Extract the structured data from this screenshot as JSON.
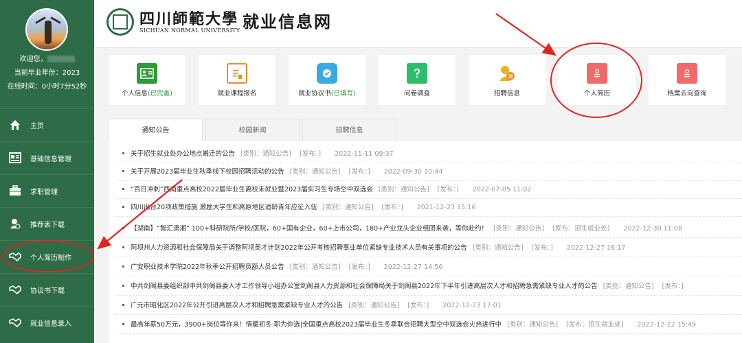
{
  "sidebar": {
    "welcome": "欢迎您，",
    "grad_year": "当前毕业年份：2023",
    "online_time": "在线时间：0小时7分52秒",
    "items": [
      {
        "label": "主页",
        "icon": "home-icon"
      },
      {
        "label": "基础信息管理",
        "icon": "id-card-icon"
      },
      {
        "label": "求职管理",
        "icon": "briefcase-icon"
      },
      {
        "label": "推荐表下载",
        "icon": "user-download-icon"
      },
      {
        "label": "个人简历制作",
        "icon": "handshake-icon"
      },
      {
        "label": "协议书下载",
        "icon": "handshake-icon"
      },
      {
        "label": "就业信息录入",
        "icon": "handshake-icon"
      }
    ]
  },
  "header": {
    "university_cn": "四川師範大學",
    "university_en": "SICHUAN NORMAL UNIVERSITY",
    "site_title": "就业信息网"
  },
  "cards": [
    {
      "label": "个人信息",
      "status": "(已完善)",
      "icon": "id-card-icon",
      "color": "#2e9a3a"
    },
    {
      "label": "就业课程报名",
      "status": "",
      "icon": "document-icon",
      "color": "#f08a24"
    },
    {
      "label": "就业协议书",
      "status": "(已填写)",
      "icon": "shield-check-icon",
      "color": "#3aa9e0"
    },
    {
      "label": "问卷调查",
      "status": "",
      "icon": "question-icon",
      "color": "#2ebd6b"
    },
    {
      "label": "招聘信息",
      "status": "",
      "icon": "recruit-icon",
      "color": "#f0b21a"
    },
    {
      "label": "个人简历",
      "status": "",
      "icon": "resume-icon",
      "color": "#f06a6a"
    },
    {
      "label": "档案去向查询",
      "status": "",
      "icon": "archive-icon",
      "color": "#f06a6a"
    }
  ],
  "tabs": [
    "通知公告",
    "校园新闻",
    "招聘信息"
  ],
  "news": [
    {
      "title": "关于招生就业处办公地点搬迁的公告",
      "category": "[类别：通知公告]",
      "publisher": "[发布：]",
      "date": "2022-11-11 09:37"
    },
    {
      "title": "关于开展2023届毕业生秋季线下校园招聘活动的公告",
      "category": "[类别：通知公告]",
      "publisher": "[发布：]",
      "date": "2022-09-30 10:44"
    },
    {
      "title": "“百日冲刺”西南重点高校2022届毕业生离校未就业暨2023届实习生专场空中双选会",
      "category": "[类别：通知公告]",
      "publisher": "[发布：]",
      "date": "2022-07-05 11:02"
    },
    {
      "title": "四川出台20项政策措施 激励大学生和高原地区适龄青年应征入伍",
      "category": "[类别：通知公告]",
      "publisher": "[发布：]",
      "date": "2021-12-23 15:16"
    },
    {
      "title": "【湖南】“智汇潇湘” 100+科研院所/学校/医院，60+国有企业，60+上市公司，180+产业龙头企业组团来袭，等你赴约！",
      "category": "[类别：通知公告]",
      "publisher": "[发布：招生就业处]",
      "date": "2022-12-30 11:08"
    },
    {
      "title": "阿坝州人力资源和社会保障局关于调整阿坝英才计划2022年公开考核招聘事业单位紧缺专业技术人员有关事项的公告",
      "category": "[类别：通知公告]",
      "publisher": "[发布：]",
      "date": "2022-12-27 16:17"
    },
    {
      "title": "广安职业技术学院2022年秋季公开招聘员额人员公告",
      "category": "[类别：通知公告]",
      "publisher": "[发布：]",
      "date": "2022-12-27 14:56"
    },
    {
      "title": "中共剑阁县委组织部中共剑阁县委人才工作领导小组办公室剑阁县人力资源和社会保障局关于剑阁县2022年下半年引进高层次人才和招聘急需紧缺专业人才的公告",
      "category": "[类别：通知公告]",
      "publisher": "[发布：]",
      "date": ""
    },
    {
      "title": "广元市昭化区2022年公开引进高层次人才和招聘急需紧缺专业人才的公告",
      "category": "[类别：通知公告]",
      "publisher": "[发布：]",
      "date": "2022-12-23 17:01"
    },
    {
      "title": "最高年薪50万元，3900+岗位等你来！情暖初冬·职为你选|全国重点高校2023届毕业生冬季联合招聘大型空中双选会火热进行中",
      "category": "[类别：通知公告]",
      "publisher": "[发布：招生就业处]",
      "date": "2022-12-22 15:49"
    }
  ],
  "colors": {
    "sidebar": "#2e6b47",
    "annotation": "#e52222"
  }
}
